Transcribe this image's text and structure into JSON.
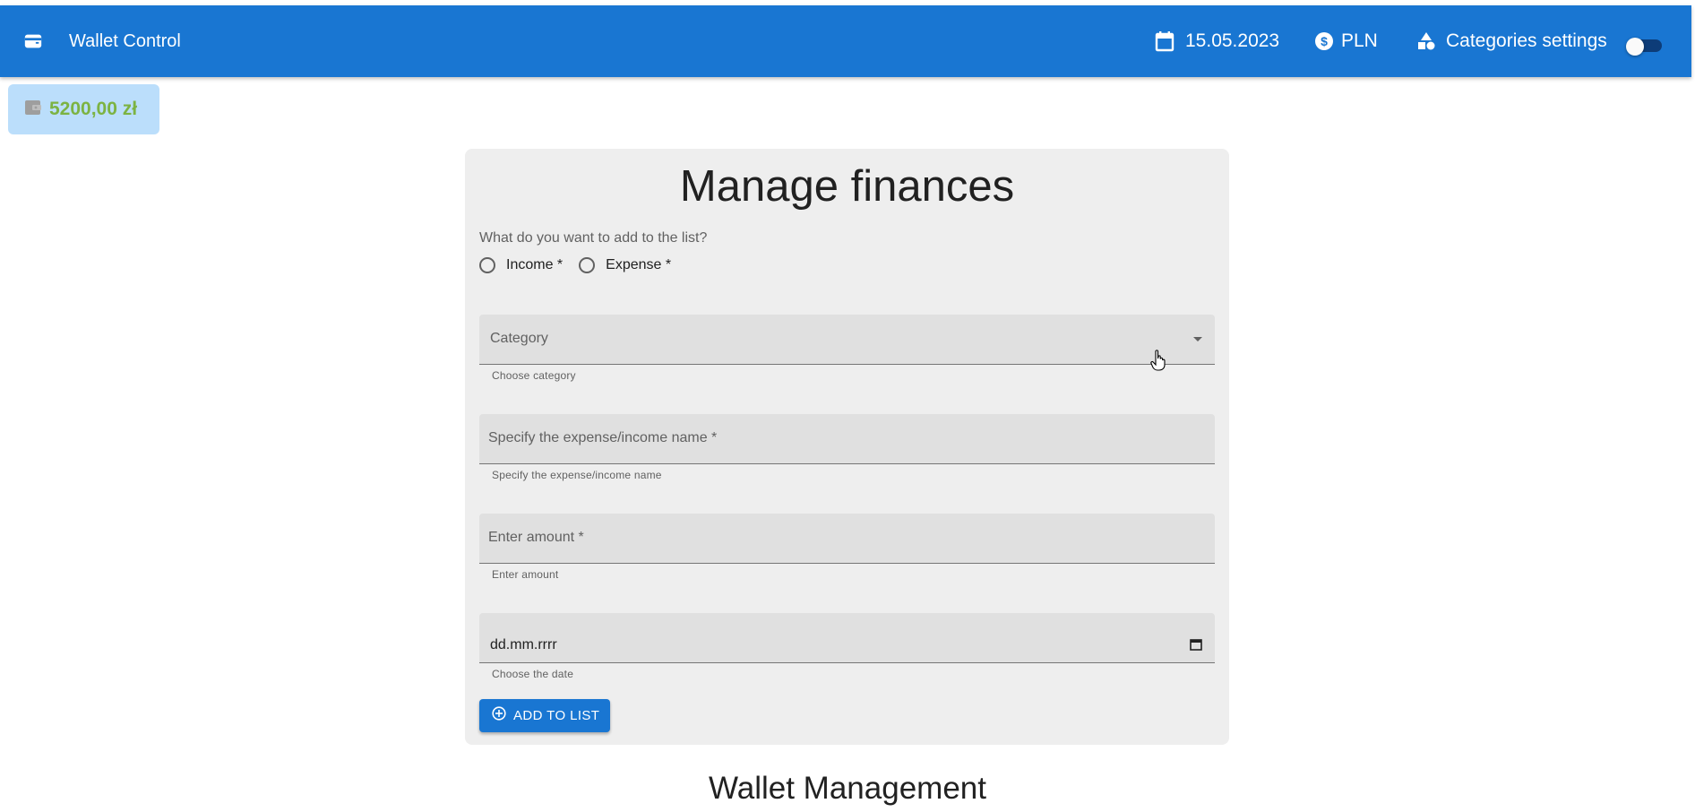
{
  "appbar": {
    "title": "Wallet Control",
    "date": "15.05.2023",
    "currency": "PLN",
    "categories_settings": "Categories settings",
    "icons": [
      "wallet-icon",
      "calendar-icon",
      "dollar-circle-icon",
      "shapes-icon",
      "theme-toggle"
    ]
  },
  "balance": {
    "amount": "5200,00 zł"
  },
  "form": {
    "title": "Manage finances",
    "question": "What do you want to add to the list?",
    "radio_income": "Income *",
    "radio_expense": "Expense *",
    "category_label": "Category",
    "category_helper": "Choose category",
    "name_label": "Specify the expense/income name *",
    "name_helper": "Specify the expense/income name",
    "amount_label": "Enter amount *",
    "amount_helper": "Enter amount",
    "date_placeholder": "dd.mm.rrrr",
    "date_helper": "Choose the date",
    "add_button": "ADD TO LIST"
  },
  "section": {
    "title": "Wallet Management"
  },
  "colors": {
    "primary": "#1976d2",
    "balance_bg": "#bbdefb",
    "balance_text": "#7cb342",
    "card_bg": "#eeeeee",
    "field_bg": "#e0e0e0"
  }
}
